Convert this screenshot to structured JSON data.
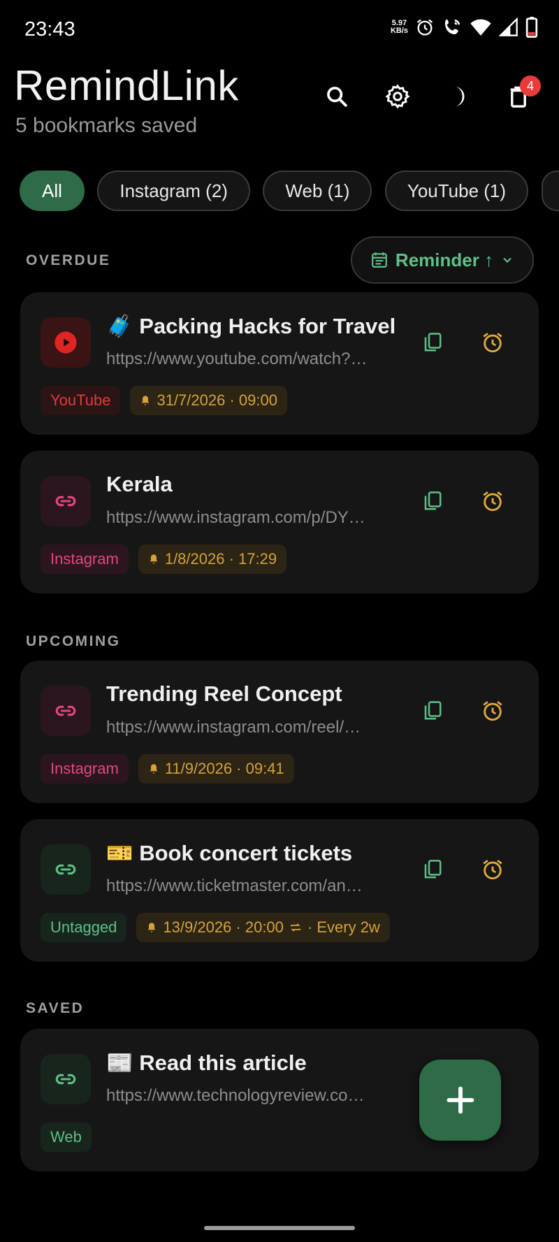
{
  "status_bar": {
    "time": "23:43",
    "net_speed_value": "5.97",
    "net_speed_unit": "KB/s"
  },
  "header": {
    "title": "RemindLink",
    "subtitle": "5 bookmarks saved",
    "trash_badge": "4"
  },
  "filters": [
    {
      "label": "All",
      "active": true
    },
    {
      "label": "Instagram (2)",
      "active": false
    },
    {
      "label": "Web (1)",
      "active": false
    },
    {
      "label": "YouTube (1)",
      "active": false
    }
  ],
  "sort": {
    "label": "Reminder ↑"
  },
  "sections": {
    "overdue": "OVERDUE",
    "upcoming": "UPCOMING",
    "saved": "SAVED"
  },
  "bookmarks": [
    {
      "title": "🧳 Packing Hacks for Travel",
      "url": "https://www.youtube.com/watch?…",
      "tag": "YouTube",
      "reminder": "31/7/2026 · 09:00"
    },
    {
      "title": "Kerala",
      "url": "https://www.instagram.com/p/DY…",
      "tag": "Instagram",
      "reminder": "1/8/2026 · 17:29"
    },
    {
      "title": "Trending Reel Concept",
      "url": "https://www.instagram.com/reel/…",
      "tag": "Instagram",
      "reminder": "11/9/2026 · 09:41"
    },
    {
      "title": "🎫 Book concert tickets",
      "url": "https://www.ticketmaster.com/an…",
      "tag": "Untagged",
      "reminder": "13/9/2026 · 20:00",
      "repeat": "· Every 2w"
    },
    {
      "title": "📰 Read this article",
      "url": "https://www.technologyreview.co…",
      "tag": "Web"
    }
  ],
  "colors": {
    "accent_green": "#2e6b47",
    "youtube_red": "#e23b3b",
    "instagram_pink": "#e2477f",
    "reminder_amber": "#d4a23c"
  }
}
